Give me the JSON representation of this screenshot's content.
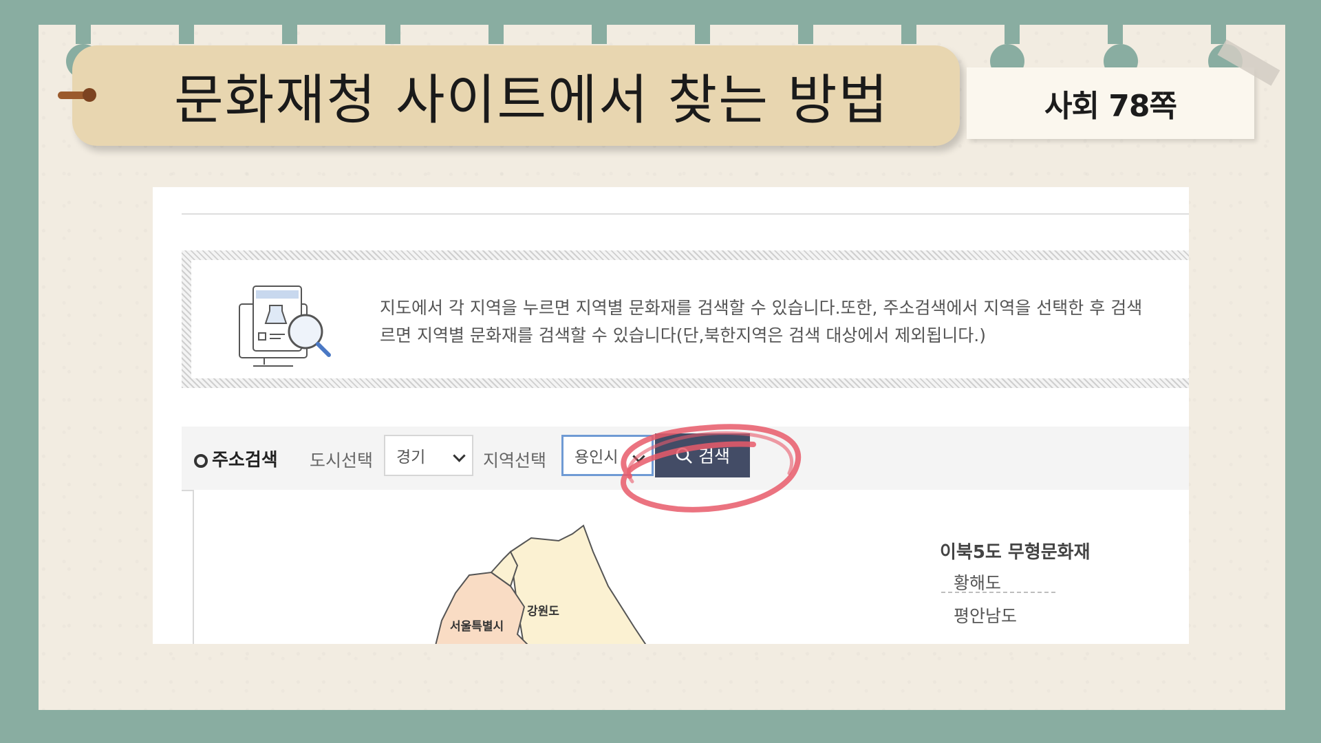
{
  "slide": {
    "title": "문화재청 사이트에서 찾는 방법",
    "page_ref": "사회 78쪽"
  },
  "site": {
    "info_lines": [
      "지도에서 각 지역을 누르면 지역별 문화재를 검색할 수 있습니다.또한, 주소검색에서 지역을 선택한 후 검색",
      "르면 지역별 문화재를 검색할 수 있습니다(단,북한지역은 검색 대상에서 제외됩니다.)"
    ],
    "search": {
      "label": "주소검색",
      "city_label": "도시선택",
      "city_value": "경기",
      "region_label": "지역선택",
      "region_value": "용인시",
      "button_label": "검색"
    },
    "map": {
      "region_gangwon": "강원도",
      "region_seoul": "서울특별시"
    },
    "side": {
      "title": "이북5도 무형문화재",
      "items": [
        "황해도",
        "평안남도"
      ]
    }
  },
  "colors": {
    "background": "#89ada1",
    "title_bar": "#e8d6b0",
    "search_button": "#434c66",
    "highlight_circle": "#e85a6a"
  }
}
